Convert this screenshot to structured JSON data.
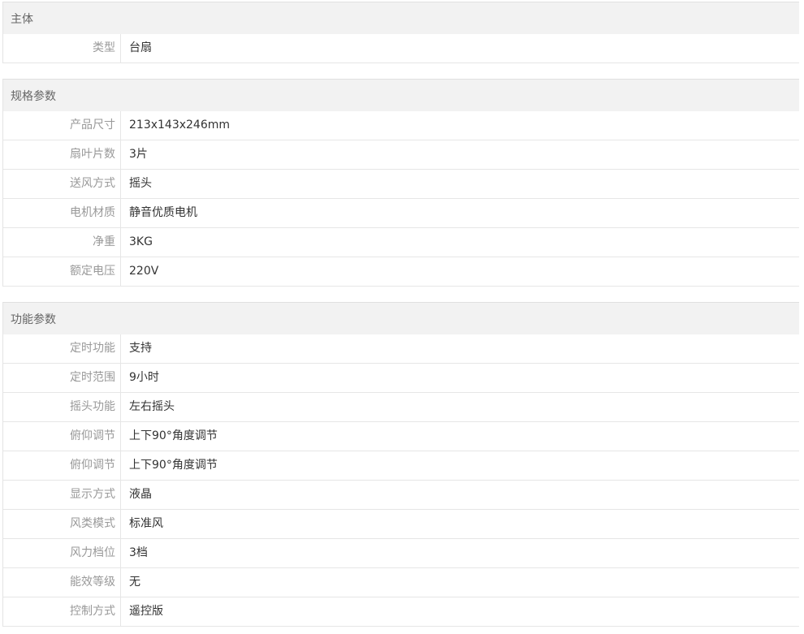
{
  "sections": [
    {
      "title": "主体",
      "rows": [
        {
          "label": "类型",
          "value": "台扇"
        }
      ]
    },
    {
      "title": "规格参数",
      "rows": [
        {
          "label": "产品尺寸",
          "value": "213x143x246mm"
        },
        {
          "label": "扇叶片数",
          "value": "3片"
        },
        {
          "label": "送风方式",
          "value": "摇头"
        },
        {
          "label": "电机材质",
          "value": "静音优质电机"
        },
        {
          "label": "净重",
          "value": "3KG"
        },
        {
          "label": "额定电压",
          "value": "220V"
        }
      ]
    },
    {
      "title": "功能参数",
      "rows": [
        {
          "label": "定时功能",
          "value": "支持"
        },
        {
          "label": "定时范围",
          "value": "9小时"
        },
        {
          "label": "摇头功能",
          "value": "左右摇头"
        },
        {
          "label": "俯仰调节",
          "value": "上下90°角度调节"
        },
        {
          "label": "俯仰调节",
          "value": "上下90°角度调节"
        },
        {
          "label": "显示方式",
          "value": "液晶"
        },
        {
          "label": "风类模式",
          "value": "标准风"
        },
        {
          "label": "风力档位",
          "value": "3档"
        },
        {
          "label": "能效等级",
          "value": "无"
        },
        {
          "label": "控制方式",
          "value": "遥控版"
        }
      ]
    }
  ]
}
